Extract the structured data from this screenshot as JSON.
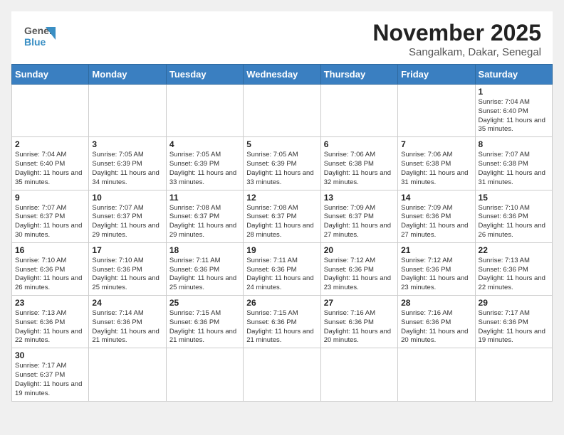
{
  "header": {
    "logo_general": "General",
    "logo_blue": "Blue",
    "month_year": "November 2025",
    "location": "Sangalkam, Dakar, Senegal"
  },
  "days_of_week": [
    "Sunday",
    "Monday",
    "Tuesday",
    "Wednesday",
    "Thursday",
    "Friday",
    "Saturday"
  ],
  "weeks": [
    [
      {
        "day": null
      },
      {
        "day": null
      },
      {
        "day": null
      },
      {
        "day": null
      },
      {
        "day": null
      },
      {
        "day": null
      },
      {
        "day": 1,
        "sunrise": "Sunrise: 7:04 AM",
        "sunset": "Sunset: 6:40 PM",
        "daylight": "Daylight: 11 hours and 35 minutes."
      }
    ],
    [
      {
        "day": 2,
        "sunrise": "Sunrise: 7:04 AM",
        "sunset": "Sunset: 6:40 PM",
        "daylight": "Daylight: 11 hours and 35 minutes."
      },
      {
        "day": 3,
        "sunrise": "Sunrise: 7:05 AM",
        "sunset": "Sunset: 6:39 PM",
        "daylight": "Daylight: 11 hours and 34 minutes."
      },
      {
        "day": 4,
        "sunrise": "Sunrise: 7:05 AM",
        "sunset": "Sunset: 6:39 PM",
        "daylight": "Daylight: 11 hours and 33 minutes."
      },
      {
        "day": 5,
        "sunrise": "Sunrise: 7:05 AM",
        "sunset": "Sunset: 6:39 PM",
        "daylight": "Daylight: 11 hours and 33 minutes."
      },
      {
        "day": 6,
        "sunrise": "Sunrise: 7:06 AM",
        "sunset": "Sunset: 6:38 PM",
        "daylight": "Daylight: 11 hours and 32 minutes."
      },
      {
        "day": 7,
        "sunrise": "Sunrise: 7:06 AM",
        "sunset": "Sunset: 6:38 PM",
        "daylight": "Daylight: 11 hours and 31 minutes."
      },
      {
        "day": 8,
        "sunrise": "Sunrise: 7:07 AM",
        "sunset": "Sunset: 6:38 PM",
        "daylight": "Daylight: 11 hours and 31 minutes."
      }
    ],
    [
      {
        "day": 9,
        "sunrise": "Sunrise: 7:07 AM",
        "sunset": "Sunset: 6:37 PM",
        "daylight": "Daylight: 11 hours and 30 minutes."
      },
      {
        "day": 10,
        "sunrise": "Sunrise: 7:07 AM",
        "sunset": "Sunset: 6:37 PM",
        "daylight": "Daylight: 11 hours and 29 minutes."
      },
      {
        "day": 11,
        "sunrise": "Sunrise: 7:08 AM",
        "sunset": "Sunset: 6:37 PM",
        "daylight": "Daylight: 11 hours and 29 minutes."
      },
      {
        "day": 12,
        "sunrise": "Sunrise: 7:08 AM",
        "sunset": "Sunset: 6:37 PM",
        "daylight": "Daylight: 11 hours and 28 minutes."
      },
      {
        "day": 13,
        "sunrise": "Sunrise: 7:09 AM",
        "sunset": "Sunset: 6:37 PM",
        "daylight": "Daylight: 11 hours and 27 minutes."
      },
      {
        "day": 14,
        "sunrise": "Sunrise: 7:09 AM",
        "sunset": "Sunset: 6:36 PM",
        "daylight": "Daylight: 11 hours and 27 minutes."
      },
      {
        "day": 15,
        "sunrise": "Sunrise: 7:10 AM",
        "sunset": "Sunset: 6:36 PM",
        "daylight": "Daylight: 11 hours and 26 minutes."
      }
    ],
    [
      {
        "day": 16,
        "sunrise": "Sunrise: 7:10 AM",
        "sunset": "Sunset: 6:36 PM",
        "daylight": "Daylight: 11 hours and 26 minutes."
      },
      {
        "day": 17,
        "sunrise": "Sunrise: 7:10 AM",
        "sunset": "Sunset: 6:36 PM",
        "daylight": "Daylight: 11 hours and 25 minutes."
      },
      {
        "day": 18,
        "sunrise": "Sunrise: 7:11 AM",
        "sunset": "Sunset: 6:36 PM",
        "daylight": "Daylight: 11 hours and 25 minutes."
      },
      {
        "day": 19,
        "sunrise": "Sunrise: 7:11 AM",
        "sunset": "Sunset: 6:36 PM",
        "daylight": "Daylight: 11 hours and 24 minutes."
      },
      {
        "day": 20,
        "sunrise": "Sunrise: 7:12 AM",
        "sunset": "Sunset: 6:36 PM",
        "daylight": "Daylight: 11 hours and 23 minutes."
      },
      {
        "day": 21,
        "sunrise": "Sunrise: 7:12 AM",
        "sunset": "Sunset: 6:36 PM",
        "daylight": "Daylight: 11 hours and 23 minutes."
      },
      {
        "day": 22,
        "sunrise": "Sunrise: 7:13 AM",
        "sunset": "Sunset: 6:36 PM",
        "daylight": "Daylight: 11 hours and 22 minutes."
      }
    ],
    [
      {
        "day": 23,
        "sunrise": "Sunrise: 7:13 AM",
        "sunset": "Sunset: 6:36 PM",
        "daylight": "Daylight: 11 hours and 22 minutes."
      },
      {
        "day": 24,
        "sunrise": "Sunrise: 7:14 AM",
        "sunset": "Sunset: 6:36 PM",
        "daylight": "Daylight: 11 hours and 21 minutes."
      },
      {
        "day": 25,
        "sunrise": "Sunrise: 7:15 AM",
        "sunset": "Sunset: 6:36 PM",
        "daylight": "Daylight: 11 hours and 21 minutes."
      },
      {
        "day": 26,
        "sunrise": "Sunrise: 7:15 AM",
        "sunset": "Sunset: 6:36 PM",
        "daylight": "Daylight: 11 hours and 21 minutes."
      },
      {
        "day": 27,
        "sunrise": "Sunrise: 7:16 AM",
        "sunset": "Sunset: 6:36 PM",
        "daylight": "Daylight: 11 hours and 20 minutes."
      },
      {
        "day": 28,
        "sunrise": "Sunrise: 7:16 AM",
        "sunset": "Sunset: 6:36 PM",
        "daylight": "Daylight: 11 hours and 20 minutes."
      },
      {
        "day": 29,
        "sunrise": "Sunrise: 7:17 AM",
        "sunset": "Sunset: 6:36 PM",
        "daylight": "Daylight: 11 hours and 19 minutes."
      }
    ],
    [
      {
        "day": 30,
        "sunrise": "Sunrise: 7:17 AM",
        "sunset": "Sunset: 6:37 PM",
        "daylight": "Daylight: 11 hours and 19 minutes."
      },
      {
        "day": null
      },
      {
        "day": null
      },
      {
        "day": null
      },
      {
        "day": null
      },
      {
        "day": null
      },
      {
        "day": null
      }
    ]
  ]
}
